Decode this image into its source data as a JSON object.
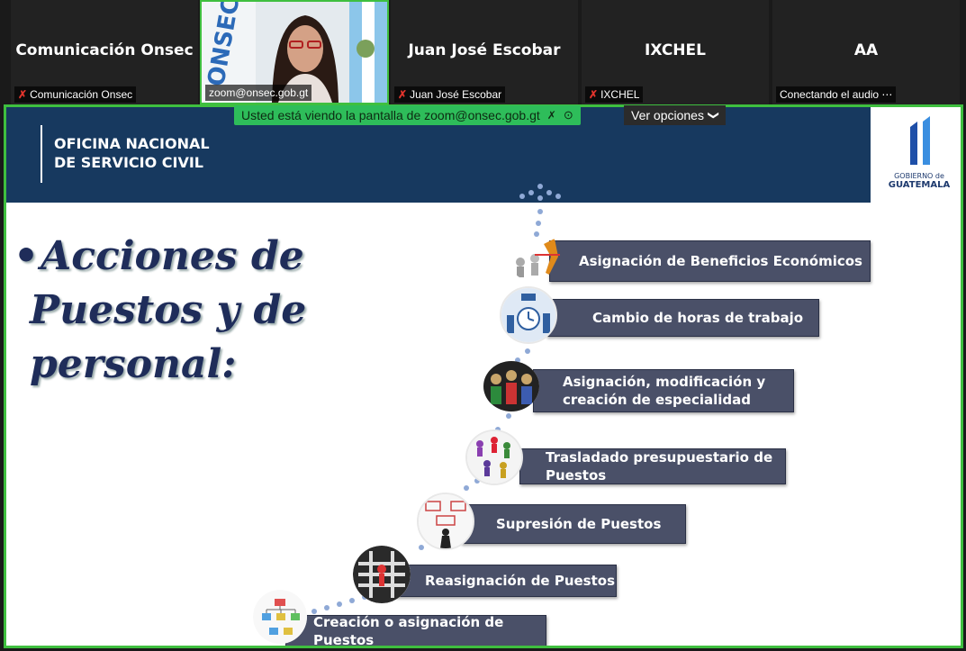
{
  "participants": [
    {
      "name": "Comunicación Onsec",
      "label": "Comunicación Onsec",
      "muted": true
    },
    {
      "name": "",
      "label": "zoom@onsec.gob.gt",
      "muted": false
    },
    {
      "name": "Juan José Escobar",
      "label": "Juan José Escobar",
      "muted": true
    },
    {
      "name": "IXCHEL",
      "label": "IXCHEL",
      "muted": true
    },
    {
      "name": "AA",
      "label": "Conectando el audio ⋯",
      "muted": false
    }
  ],
  "share_banner": {
    "text": "Usted está viendo la pantalla de zoom@onsec.gob.gt",
    "options_label": "Ver opciones"
  },
  "slide": {
    "org_line1": "OFICINA NACIONAL",
    "org_line2": "DE SERVICIO CIVIL",
    "logo_line1": "GOBIERNO de",
    "logo_line2": "GUATEMALA",
    "bullet": "•",
    "heading_line1": "Acciones de",
    "heading_line2": "Puestos y de",
    "heading_line3": "personal:",
    "items": [
      {
        "l1": "Asignación de Beneficios Económicos",
        "l2": ""
      },
      {
        "l1": "Cambio de horas de trabajo",
        "l2": ""
      },
      {
        "l1": "Asignación, modificación y",
        "l2": "creación de especialidad"
      },
      {
        "l1": "Trasladado presupuestario  de",
        "l2": "Puestos"
      },
      {
        "l1": "Supresión de Puestos",
        "l2": ""
      },
      {
        "l1": "Reasignación de Puestos",
        "l2": ""
      },
      {
        "l1": "Creación o asignación de Puestos",
        "l2": ""
      }
    ]
  }
}
